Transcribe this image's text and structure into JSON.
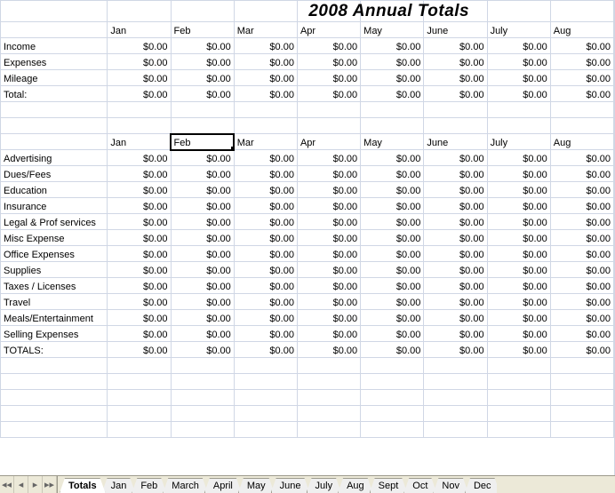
{
  "title": "2008 Annual Totals",
  "months": [
    "Jan",
    "Feb",
    "Mar",
    "Apr",
    "May",
    "June",
    "July",
    "Aug"
  ],
  "zero": "$0.00",
  "section1_rows": [
    "Income",
    "Expenses",
    "Mileage",
    "Total:"
  ],
  "section2_rows": [
    "Advertising",
    "Dues/Fees",
    "Education",
    "Insurance",
    "Legal & Prof services",
    "Misc Expense",
    "Office Expenses",
    "Supplies",
    "Taxes / Licenses",
    "Travel",
    "Meals/Entertainment",
    "Selling Expenses",
    "TOTALS:"
  ],
  "tabs": [
    "Totals",
    "Jan",
    "Feb",
    "March",
    "April",
    "May",
    "June",
    "July",
    "Aug",
    "Sept",
    "Oct",
    "Nov",
    "Dec"
  ],
  "active_tab": "Totals",
  "selected_cell": {
    "section": 2,
    "col": 1
  },
  "nav_icons": {
    "first": "◂◂",
    "prev": "◂",
    "next": "▸",
    "last": "▸▸"
  }
}
